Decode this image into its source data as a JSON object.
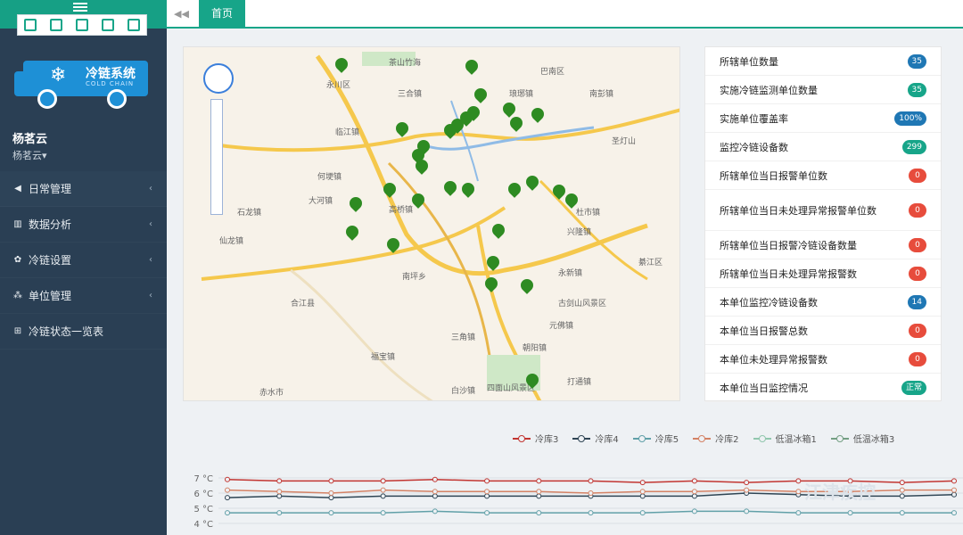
{
  "sidebar": {
    "logo": {
      "title": "冷链系统",
      "subtitle": "COLD CHAIN"
    },
    "user": {
      "name": "杨茗云",
      "sub": "杨茗云▾"
    },
    "menu": [
      {
        "label": "日常管理",
        "icon": "megaphone-icon"
      },
      {
        "label": "数据分析",
        "icon": "bar-chart-icon"
      },
      {
        "label": "冷链设置",
        "icon": "gear-icon"
      },
      {
        "label": "单位管理",
        "icon": "sitemap-icon"
      },
      {
        "label": "冷链状态一览表",
        "icon": "plus-square-icon"
      }
    ]
  },
  "header": {
    "tab": "首页"
  },
  "map": {
    "labels": [
      "茶山竹海",
      "永川区",
      "巴南区",
      "三合镇",
      "南彭镇",
      "琅琊镇",
      "临江镇",
      "圣灯山",
      "大河镇",
      "何埂镇",
      "石龙镇",
      "仙龙镇",
      "兴隆镇",
      "杜市镇",
      "永新镇",
      "古剑山风景区",
      "綦江区",
      "南坪乡",
      "合江县",
      "福宝镇",
      "赤水市",
      "四面山风景区",
      "打通镇",
      "三角镇",
      "白沙镇",
      "朝阳镇",
      "元佛镇",
      "高桥镇"
    ]
  },
  "stats": [
    {
      "label": "所辖单位数量",
      "value": "35",
      "color": "#1f77b4"
    },
    {
      "label": "实施冷链监测单位数量",
      "value": "35",
      "color": "#17a589"
    },
    {
      "label": "实施单位覆盖率",
      "value": "100%",
      "color": "#1f77b4"
    },
    {
      "label": "监控冷链设备数",
      "value": "299",
      "color": "#17a589"
    },
    {
      "label": "所辖单位当日报警单位数",
      "value": "0",
      "color": "#e74c3c"
    },
    {
      "label": "所辖单位当日未处理异常报警单位数",
      "value": "0",
      "color": "#e74c3c"
    },
    {
      "label": "所辖单位当日报警冷链设备数量",
      "value": "0",
      "color": "#e74c3c"
    },
    {
      "label": "所辖单位当日未处理异常报警数",
      "value": "0",
      "color": "#e74c3c"
    },
    {
      "label": "本单位监控冷链设备数",
      "value": "14",
      "color": "#1f77b4"
    },
    {
      "label": "本单位当日报警总数",
      "value": "0",
      "color": "#e74c3c"
    },
    {
      "label": "本单位未处理异常报警数",
      "value": "0",
      "color": "#e74c3c"
    },
    {
      "label": "本单位当日监控情况",
      "value": "正常",
      "color": "#17a589"
    }
  ],
  "chart_data": {
    "type": "line",
    "legend": [
      {
        "name": "冷库3",
        "color": "#c23531"
      },
      {
        "name": "冷库4",
        "color": "#2f4554"
      },
      {
        "name": "冷库5",
        "color": "#61a0a8"
      },
      {
        "name": "冷库2",
        "color": "#d48265"
      },
      {
        "name": "低温冰箱1",
        "color": "#91c7ae"
      },
      {
        "name": "低温冰箱3",
        "color": "#749f83"
      }
    ],
    "yticks": [
      "7 °C",
      "6 °C",
      "5 °C",
      "4 °C"
    ],
    "series": [
      {
        "name": "冷库3",
        "color": "#c23531",
        "values": [
          6.9,
          6.8,
          6.8,
          6.8,
          6.9,
          6.8,
          6.8,
          6.8,
          6.7,
          6.8,
          6.7,
          6.8,
          6.8,
          6.7,
          6.8
        ]
      },
      {
        "name": "冷库4",
        "color": "#2f4554",
        "values": [
          5.7,
          5.8,
          5.7,
          5.8,
          5.8,
          5.8,
          5.8,
          5.8,
          5.8,
          5.8,
          6.0,
          5.9,
          5.8,
          5.8,
          5.9
        ]
      },
      {
        "name": "冷库2",
        "color": "#d48265",
        "values": [
          6.2,
          6.1,
          6.0,
          6.2,
          6.1,
          6.1,
          6.1,
          6.0,
          6.1,
          6.1,
          6.2,
          6.1,
          6.1,
          6.2,
          6.2
        ]
      },
      {
        "name": "冷库5",
        "color": "#61a0a8",
        "values": [
          4.7,
          4.7,
          4.7,
          4.7,
          4.8,
          4.7,
          4.7,
          4.7,
          4.7,
          4.8,
          4.8,
          4.7,
          4.7,
          4.7,
          4.7
        ]
      }
    ]
  },
  "watermark": "江津疾控"
}
